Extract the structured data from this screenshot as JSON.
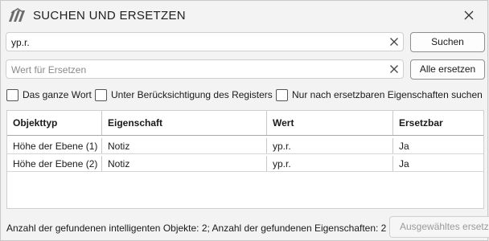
{
  "window": {
    "title": "SUCHEN UND ERSETZEN",
    "brand_color": "#6b6b6b"
  },
  "search": {
    "value": "yp.r.",
    "placeholder": "",
    "button_label": "Suchen"
  },
  "replace": {
    "value": "",
    "placeholder": "Wert für Ersetzen",
    "button_label": "Alle ersetzen"
  },
  "options": [
    {
      "label": "Das ganze Wort",
      "checked": false
    },
    {
      "label": "Unter Berücksichtigung des Registers",
      "checked": false
    },
    {
      "label": "Nur nach ersetzbaren Eigenschaften suchen",
      "checked": false
    }
  ],
  "table": {
    "columns": [
      "Objekttyp",
      "Eigenschaft",
      "Wert",
      "Ersetzbar"
    ],
    "rows": [
      [
        "Höhe der Ebene (1)",
        "Notiz",
        "yp.r.",
        "Ja"
      ],
      [
        "Höhe der Ebene (2)",
        "Notiz",
        "yp.r.",
        "Ja"
      ]
    ]
  },
  "status": {
    "text": "Anzahl der gefundenen intelligenten Objekte: 2; Anzahl der gefundenen Eigenschaften: 2"
  },
  "footer": {
    "replace_selected_label": "Ausgewähltes ersetzen"
  },
  "icons": {
    "logo": "app-logo-icon",
    "close": "close-icon",
    "clear": "clear-icon"
  }
}
